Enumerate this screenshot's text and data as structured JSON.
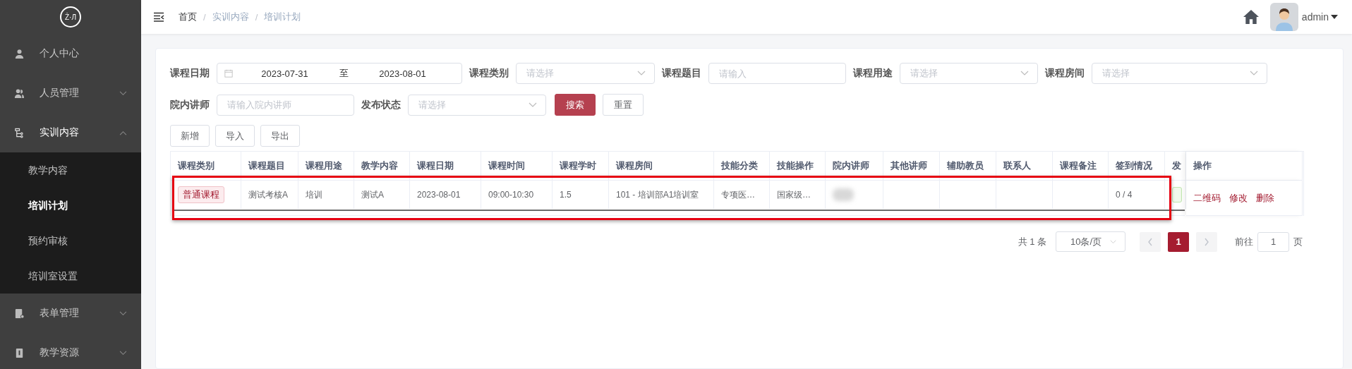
{
  "logo": "Ż·Л",
  "sidebar": {
    "items": [
      {
        "label": "个人中心",
        "kind": "link",
        "expanded": false
      },
      {
        "label": "人员管理",
        "kind": "group",
        "expanded": false
      },
      {
        "label": "实训内容",
        "kind": "group",
        "expanded": true,
        "children": [
          {
            "label": "教学内容",
            "selected": false
          },
          {
            "label": "培训计划",
            "selected": true
          },
          {
            "label": "预约审核",
            "selected": false
          },
          {
            "label": "培训室设置",
            "selected": false
          }
        ]
      },
      {
        "label": "表单管理",
        "kind": "group",
        "expanded": false
      },
      {
        "label": "教学资源",
        "kind": "group",
        "expanded": false
      }
    ]
  },
  "breadcrumb": [
    "首页",
    "实训内容",
    "培训计划"
  ],
  "breadcrumb_separator": "/",
  "user": {
    "name": "admin"
  },
  "filters": [
    {
      "label": "课程日期",
      "kind": "daterange",
      "start": "2023-07-31",
      "separator": "至",
      "end": "2023-08-01"
    },
    {
      "label": "课程类别",
      "kind": "select",
      "placeholder": "请选择"
    },
    {
      "label": "课程题目",
      "kind": "input",
      "placeholder": "请输入"
    },
    {
      "label": "课程用途",
      "kind": "select",
      "placeholder": "请选择"
    },
    {
      "label": "课程房间",
      "kind": "select",
      "placeholder": "请选择"
    },
    {
      "label": "院内讲师",
      "kind": "input",
      "placeholder": "请输入院内讲师"
    },
    {
      "label": "发布状态",
      "kind": "select",
      "placeholder": "请选择"
    }
  ],
  "filter_buttons": [
    {
      "label": "搜索",
      "primary": true
    },
    {
      "label": "重置",
      "primary": false
    }
  ],
  "toolbar": [
    "新增",
    "导入",
    "导出"
  ],
  "table": {
    "columns": [
      "课程类别",
      "课程题目",
      "课程用途",
      "教学内容",
      "课程日期",
      "课程时间",
      "课程学时",
      "课程房间",
      "技能分类",
      "技能操作",
      "院内讲师",
      "其他讲师",
      "辅助教员",
      "联系人",
      "课程备注",
      "签到情况",
      "发"
    ],
    "actions_column": "操作",
    "rows": [
      {
        "highlighted": true,
        "cells": [
          {
            "kind": "tag",
            "text": "普通课程"
          },
          {
            "kind": "text",
            "text": "测试考核A"
          },
          {
            "kind": "text",
            "text": "培训"
          },
          {
            "kind": "text",
            "text": "测试A"
          },
          {
            "kind": "text",
            "text": "2023-08-01"
          },
          {
            "kind": "text",
            "text": "09:00-10:30"
          },
          {
            "kind": "text",
            "text": "1.5"
          },
          {
            "kind": "text",
            "text": "101 - 培训部A1培训室"
          },
          {
            "kind": "text",
            "text": "专项医…"
          },
          {
            "kind": "text",
            "text": "国家级…"
          },
          {
            "kind": "blurred"
          },
          {
            "kind": "empty"
          },
          {
            "kind": "empty"
          },
          {
            "kind": "empty"
          },
          {
            "kind": "empty"
          },
          {
            "kind": "text",
            "text": "0 / 4"
          },
          {
            "kind": "status"
          }
        ],
        "actions": [
          "二维码",
          "修改",
          "删除"
        ]
      }
    ]
  },
  "pagination": {
    "total": "共 1 条",
    "page_size": "10条/页",
    "pages": [
      {
        "label": "1",
        "selected": true
      }
    ],
    "goto_label": "前往",
    "goto_value": "1",
    "page_unit": "页"
  }
}
